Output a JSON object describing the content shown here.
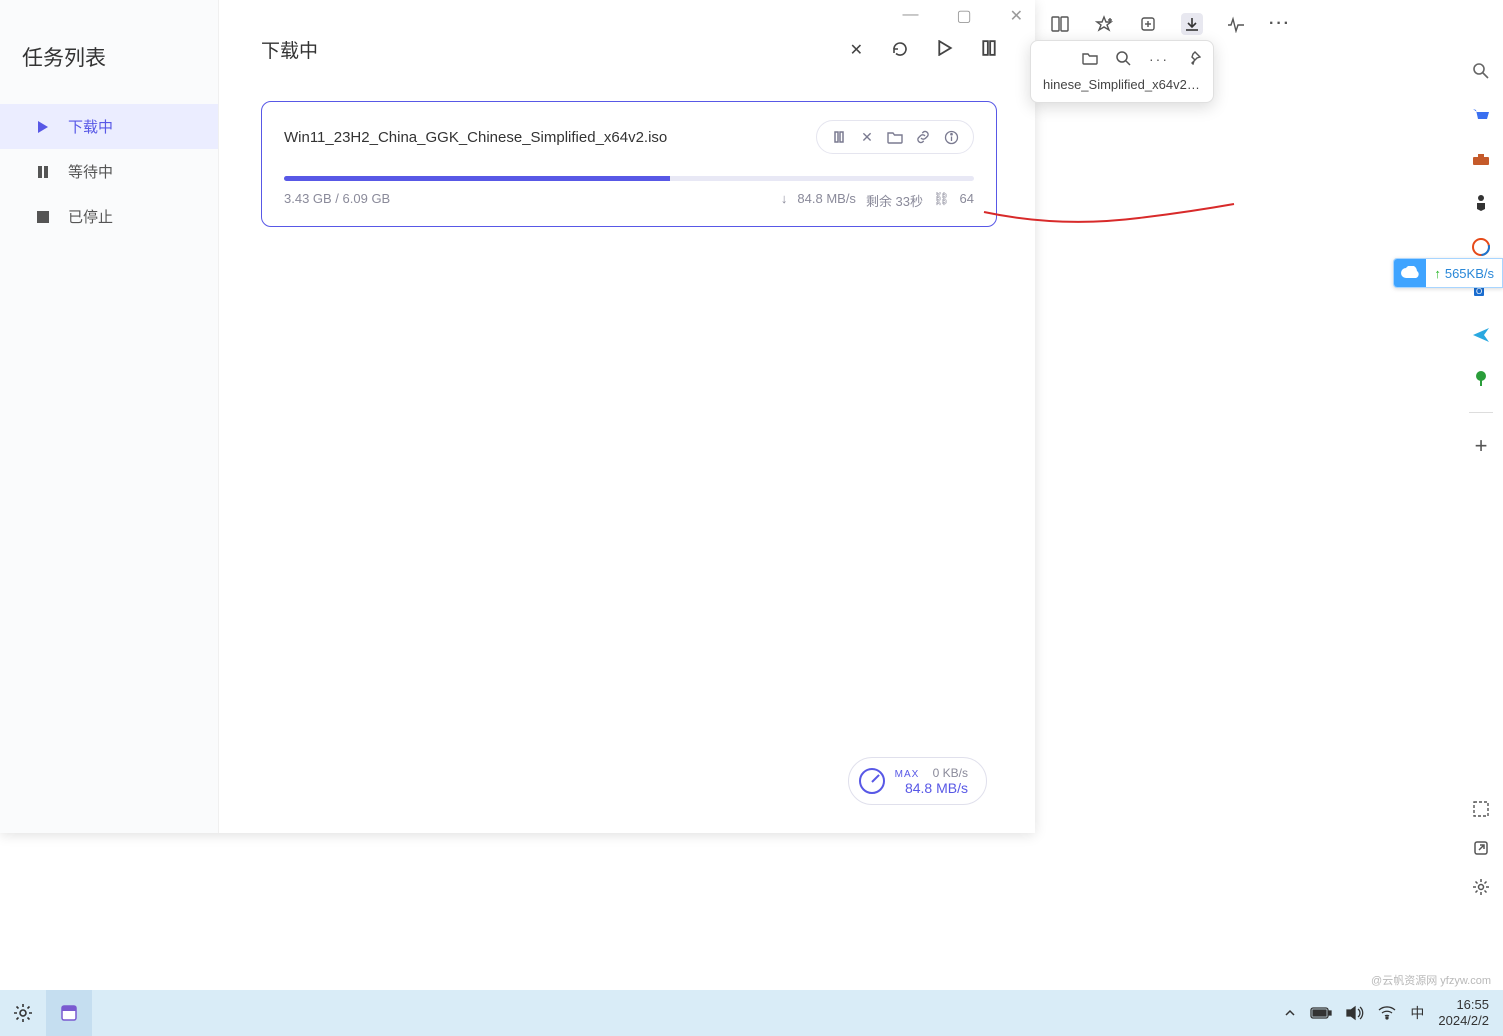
{
  "sidebar": {
    "title": "任务列表",
    "items": [
      {
        "label": "下载中"
      },
      {
        "label": "等待中"
      },
      {
        "label": "已停止"
      }
    ]
  },
  "main": {
    "title": "下载中"
  },
  "download": {
    "filename": "Win11_23H2_China_GGK_Chinese_Simplified_x64v2.iso",
    "progress_text": "3.43 GB / 6.09 GB",
    "progress_percent": 56,
    "speed": "84.8 MB/s",
    "remaining": "剩余 33秒",
    "connections": "64"
  },
  "speedbox": {
    "max_label": "MAX",
    "upload": "0 KB/s",
    "download": "84.8 MB/s"
  },
  "browser_popup": {
    "filename": "hinese_Simplified_x64v2...."
  },
  "cloud_widget": {
    "speed": "565KB/s"
  },
  "taskbar": {
    "ime": "中",
    "time": "16:55",
    "date": "2024/2/2"
  },
  "watermark": "@云帆资源网 yfzyw.com"
}
